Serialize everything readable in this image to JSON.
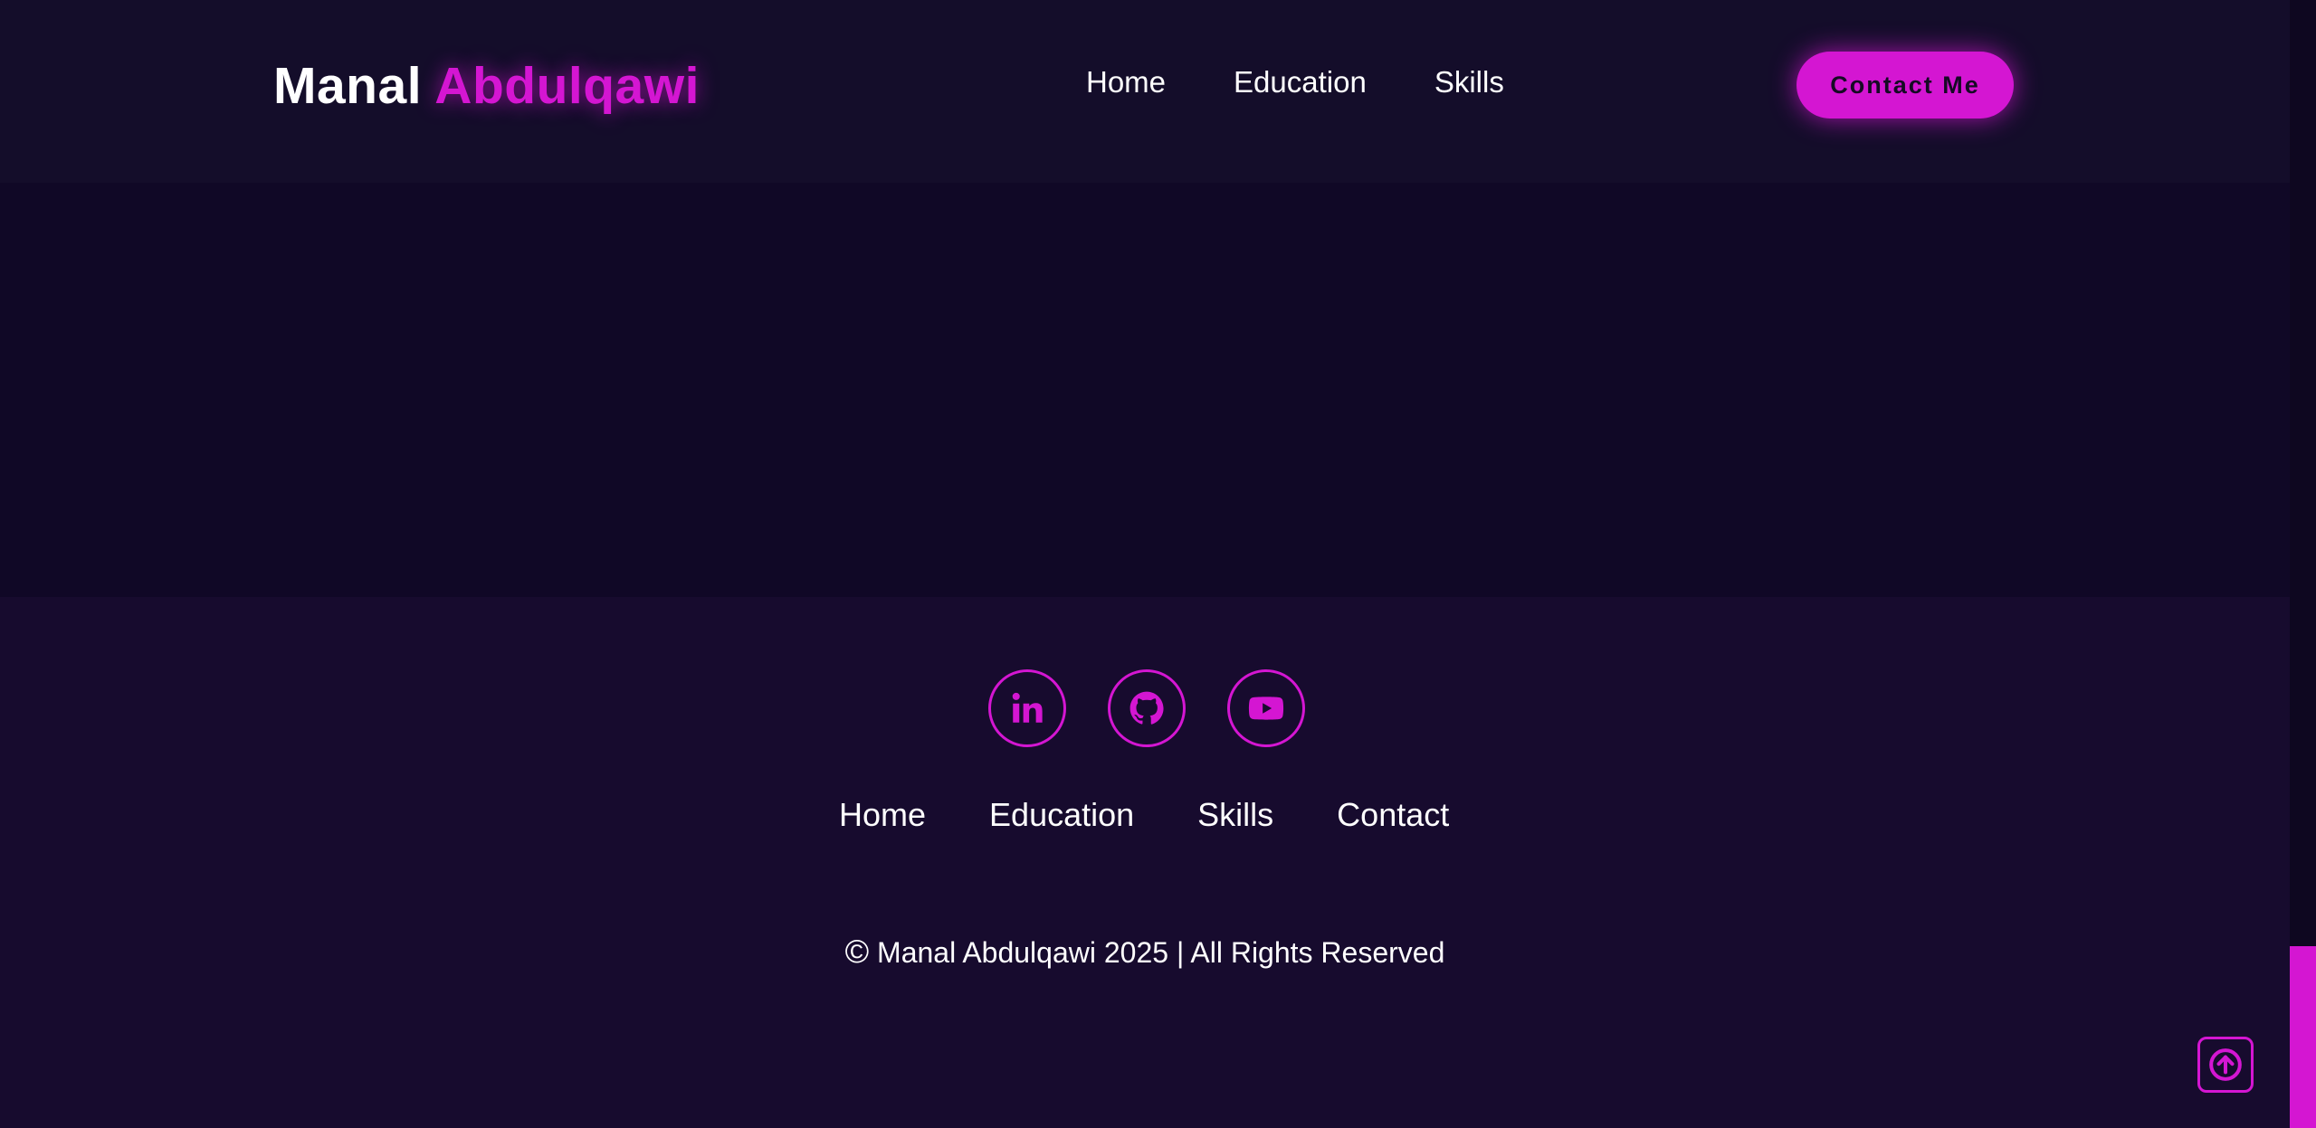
{
  "header": {
    "logo_first": "Manal",
    "logo_last": "Abdulqawi",
    "nav": [
      {
        "label": "Home"
      },
      {
        "label": "Education"
      },
      {
        "label": "Skills"
      }
    ],
    "contact_button": "Contact Me"
  },
  "footer": {
    "socials": [
      {
        "icon": "linkedin-icon"
      },
      {
        "icon": "github-icon"
      },
      {
        "icon": "youtube-icon"
      }
    ],
    "nav": [
      {
        "label": "Home"
      },
      {
        "label": "Education"
      },
      {
        "label": "Skills"
      },
      {
        "label": "Contact"
      }
    ],
    "copyright_symbol": "©",
    "copyright_text": "Manal Abdulqawi 2025 | All Rights Reserved"
  },
  "scroll_top": {
    "icon": "arrow-up-icon"
  },
  "colors": {
    "accent": "#d416d2",
    "header_bg": "#140d2a",
    "main_bg": "#100826",
    "footer_bg": "#170b2e",
    "text": "#ffffff"
  }
}
